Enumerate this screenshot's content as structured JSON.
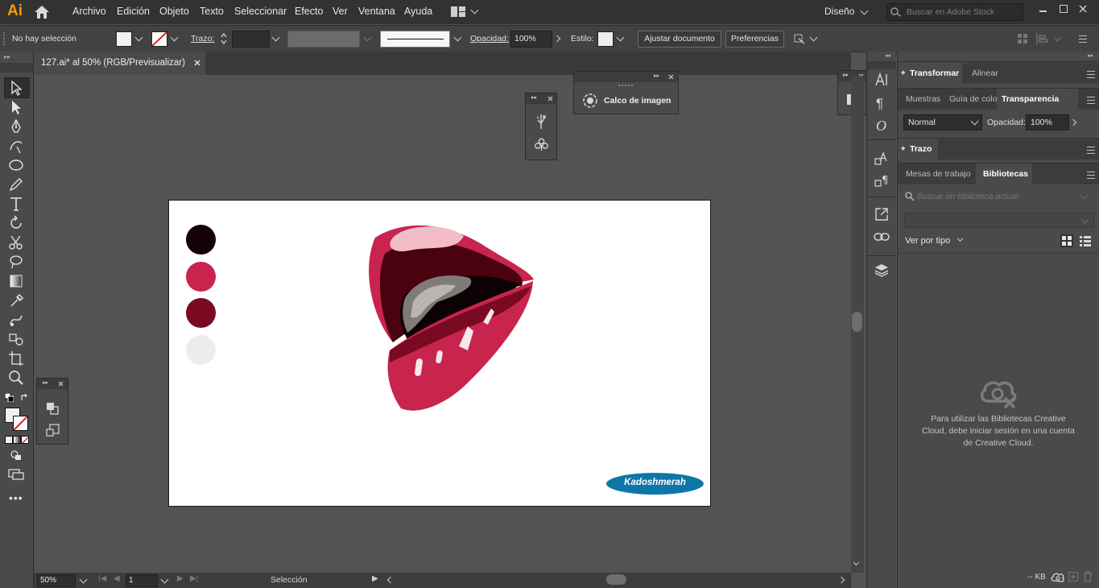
{
  "app": {
    "logo": "Ai",
    "menu": [
      "Archivo",
      "Edición",
      "Objeto",
      "Texto",
      "Seleccionar",
      "Efecto",
      "Ver",
      "Ventana",
      "Ayuda"
    ],
    "workspace": "Diseño",
    "stock_search_placeholder": "Buscar en Adobe Stock",
    "accent_color": "#ff9a00"
  },
  "control_bar": {
    "selection_status": "No hay selección",
    "stroke_label": "Trazo:",
    "opacity_label": "Opacidad:",
    "opacity_value": "100%",
    "style_label": "Estilo:",
    "fit_document_button": "Ajustar documento",
    "preferences_button": "Preferencias"
  },
  "document": {
    "tab_title": "127.ai* al 50% (RGB/Previsualizar)"
  },
  "artboard": {
    "swatches": [
      "#130208",
      "#c8244d",
      "#7a0a22",
      "#ececed"
    ],
    "watermark": "Kadoshmerah",
    "watermark_color": "#0f77a8"
  },
  "floating_panels": {
    "image_trace": "Calco de imagen"
  },
  "right_panel": {
    "tabs_row1": [
      "Transformar",
      "Alinear"
    ],
    "tabs_row2": [
      "Muestras",
      "Guía de colo",
      "Transparencia"
    ],
    "blend_mode": "Normal",
    "opacity_label": "Opacidad:",
    "opacity_value": "100%",
    "stroke_panel": "Trazo",
    "tabs_row3": [
      "Mesas de trabajo",
      "Bibliotecas"
    ],
    "library_search_placeholder": "Buscar en biblioteca actual",
    "view_by_type": "Ver por tipo",
    "libraries_message": "Para utilizar las Bibliotecas Creative Cloud, debe iniciar sesión en una cuenta de Creative Cloud.",
    "kb_label": "-- KB"
  },
  "status_bar": {
    "zoom": "50%",
    "artboard_number": "1",
    "tool_status": "Selección"
  }
}
